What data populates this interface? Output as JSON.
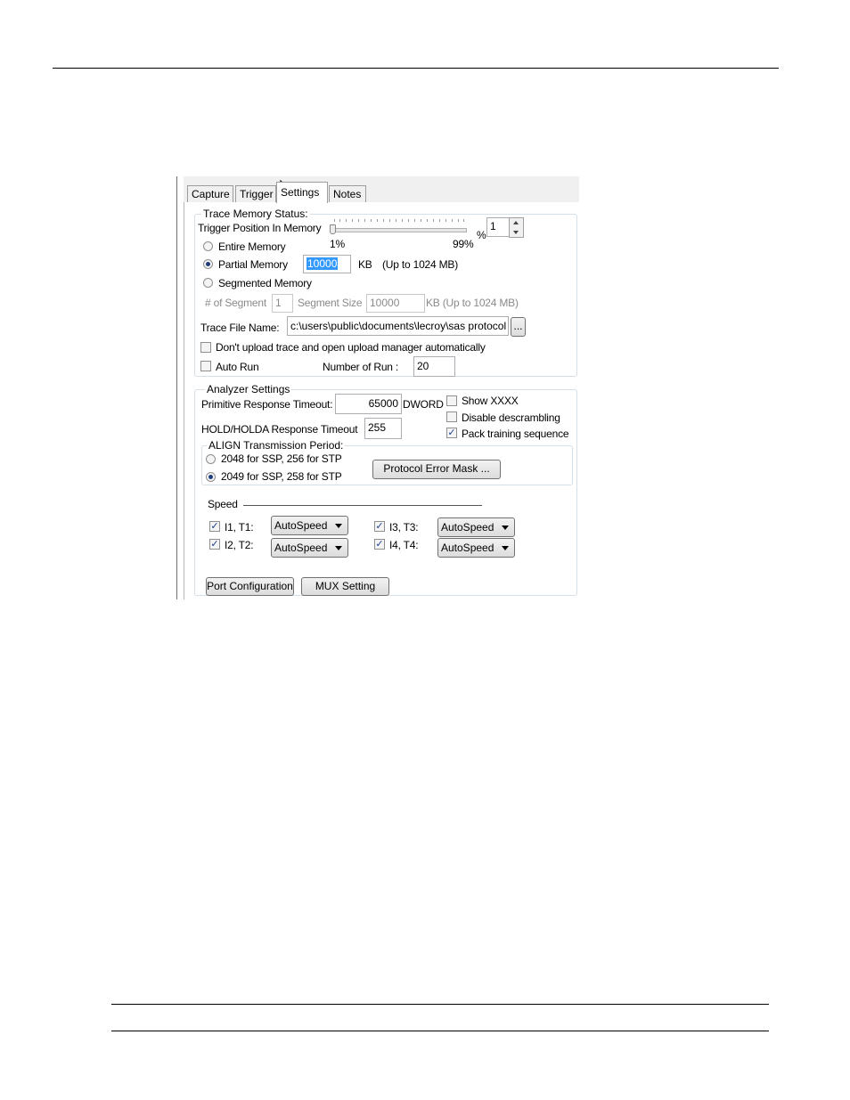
{
  "tabs": [
    "Capture",
    "Trigger",
    "Settings",
    "Notes"
  ],
  "trace_memory": {
    "legend": "Trace Memory Status:",
    "trigger_position_label": "Trigger Position In Memory",
    "percent_sign": "%",
    "trigger_position_value": "1",
    "slider_min": "1%",
    "slider_max": "99%",
    "entire_memory": "Entire Memory",
    "partial_memory": "Partial Memory",
    "partial_memory_value": "10000",
    "kb_label": "KB",
    "kb_hint": "(Up to 1024 MB)",
    "segmented_memory": "Segmented Memory",
    "segment_count_label": "# of Segment",
    "segment_count_value": "1",
    "segment_size_label": "Segment Size",
    "segment_size_value": "10000",
    "segment_kb_hint": "KB  (Up to 1024 MB)",
    "trace_file_label": "Trace File Name:",
    "trace_file_value": "c:\\users\\public\\documents\\lecroy\\sas protocol",
    "browse_label": "...",
    "dont_upload_label": "Don't upload trace and open upload manager automatically",
    "auto_run_label": "Auto Run",
    "number_of_run_label": "Number of Run :",
    "number_of_run_value": "20"
  },
  "analyzer": {
    "legend": "Analyzer Settings",
    "primitive_timeout_label": "Primitive Response Timeout:",
    "primitive_timeout_value": "65000",
    "dword_label": "DWORD",
    "show_xxxx": "Show XXXX",
    "disable_descrambling": "Disable descrambling",
    "pack_training": "Pack training sequence",
    "hold_timeout_label": "HOLD/HOLDA Response Timeout",
    "hold_timeout_value": "255",
    "align_legend": "ALIGN Transmission Period:",
    "align_option1": "2048 for SSP, 256 for STP",
    "align_option2": "2049 for SSP, 258 for STP",
    "protocol_error_mask": "Protocol Error Mask ...",
    "speed_label": "Speed",
    "ports": [
      {
        "label": "I1, T1:",
        "value": "AutoSpeed"
      },
      {
        "label": "I2, T2:",
        "value": "AutoSpeed"
      },
      {
        "label": "I3, T3:",
        "value": "AutoSpeed"
      },
      {
        "label": "I4, T4:",
        "value": "AutoSpeed"
      }
    ],
    "port_configuration": "Port Configuration",
    "mux_setting": "MUX Setting"
  },
  "state": {
    "active_tab": "Settings",
    "memory_mode": "Partial Memory",
    "align_selected": "2049 for SSP, 258 for STP",
    "checked": [
      "Pack training sequence",
      "I1, T1:",
      "I2, T2:",
      "I3, T3:",
      "I4, T4:"
    ]
  }
}
